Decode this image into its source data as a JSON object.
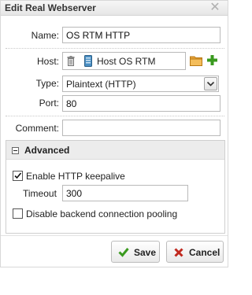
{
  "dialog": {
    "title": "Edit Real Webserver",
    "close_icon": "close-icon"
  },
  "form": {
    "name": {
      "label": "Name:",
      "value": "OS RTM HTTP"
    },
    "host": {
      "label": "Host:",
      "value": "Host OS RTM",
      "trash_icon": "trash-icon",
      "server_icon": "server-icon",
      "folder_icon": "folder-icon",
      "add_icon": "plus-icon"
    },
    "type": {
      "label": "Type:",
      "value": "Plaintext (HTTP)"
    },
    "port": {
      "label": "Port:",
      "value": "80"
    },
    "comment": {
      "label": "Comment:",
      "value": ""
    }
  },
  "advanced": {
    "title": "Advanced",
    "keepalive": {
      "label": "Enable HTTP keepalive",
      "checked": true
    },
    "timeout": {
      "label": "Timeout",
      "value": "300"
    },
    "pooling": {
      "label": "Disable backend connection pooling",
      "checked": false
    }
  },
  "footer": {
    "save_label": "Save",
    "cancel_label": "Cancel"
  },
  "colors": {
    "save_check": "#3a9a1f",
    "cancel_x": "#c0281e",
    "folder": "#e8a33a",
    "add": "#3a9a1f",
    "server": "#4a8fc4"
  }
}
